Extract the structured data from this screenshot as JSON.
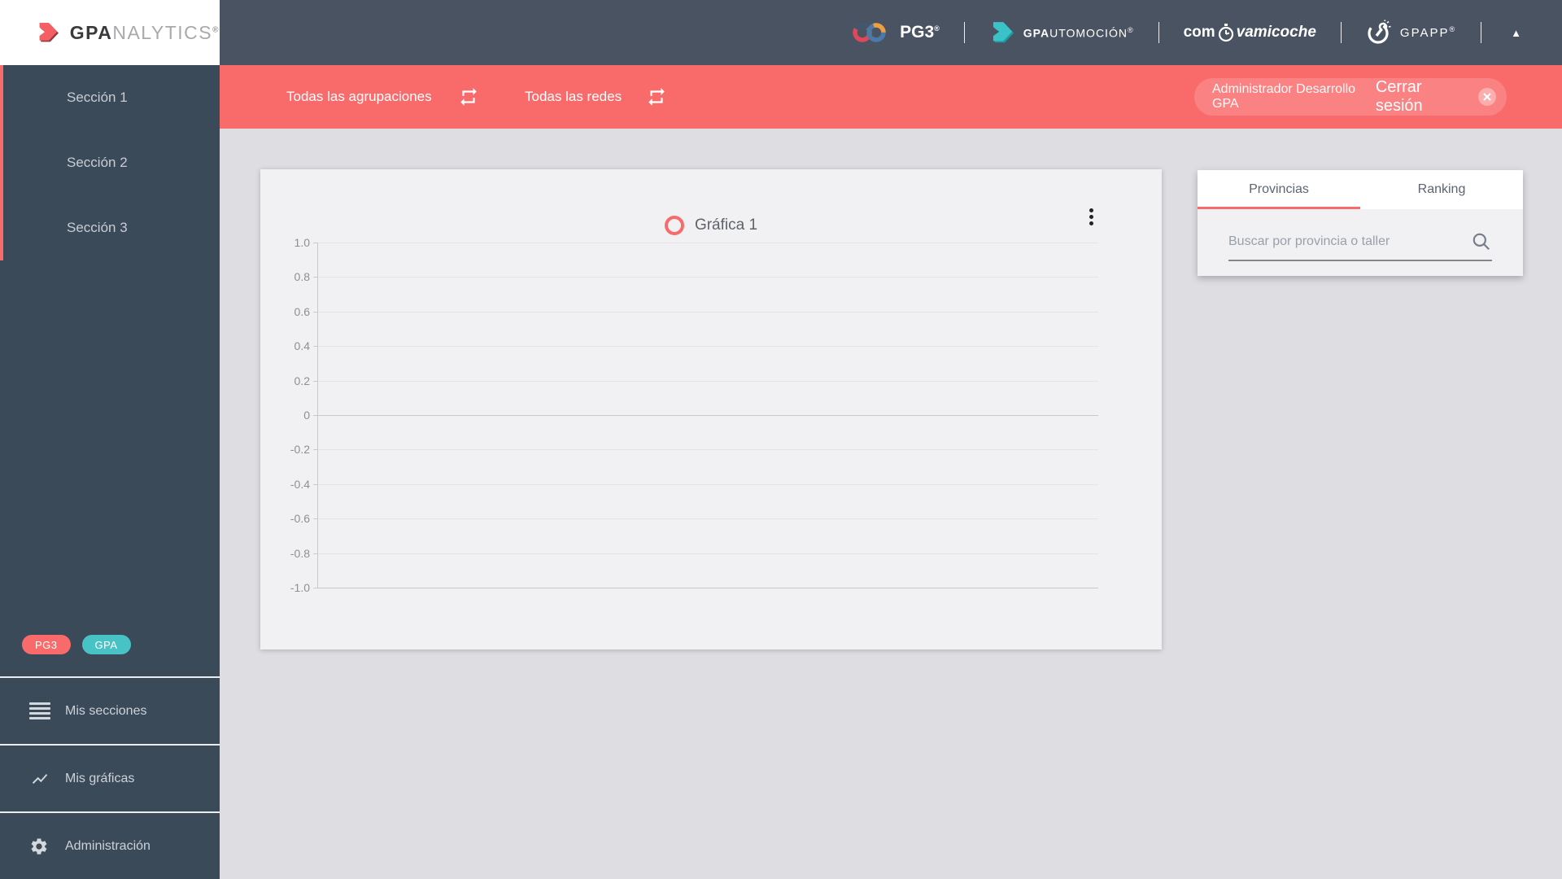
{
  "app": {
    "logo_bold": "GPA",
    "logo_light": "NALYTICS",
    "logo_reg": "®"
  },
  "sidebar": {
    "sections": [
      {
        "label": "Sección 1"
      },
      {
        "label": "Sección 2"
      },
      {
        "label": "Sección 3"
      }
    ],
    "badges": {
      "pg3": "PG3",
      "gpa": "GPA"
    },
    "menu": {
      "secciones": "Mis secciones",
      "graficas": "Mis gráficas",
      "administracion": "Administración"
    }
  },
  "header": {
    "pg3": "PG3",
    "pg3_reg": "®",
    "gpauto_bold": "GPA",
    "gpauto_rest": "UTOMOCIÓN",
    "gpauto_reg": "®",
    "comprova_left": "com",
    "comprova_right": "vamicoche",
    "gpapp": "GPAPP",
    "gpapp_reg": "®",
    "collapse_icon": "▲"
  },
  "filterbar": {
    "agrupaciones": "Todas las agrupaciones",
    "redes": "Todas las redes",
    "user": "Administrador Desarrollo GPA",
    "logout": "Cerrar sesión"
  },
  "chart_card": {
    "legend": "Gráfica 1"
  },
  "chart_data": {
    "type": "line",
    "title": "Gráfica 1",
    "series": [
      {
        "name": "Gráfica 1",
        "x": [],
        "values": []
      }
    ],
    "y_ticks": [
      "1.0",
      "0.8",
      "0.6",
      "0.4",
      "0.2",
      "0",
      "-0.2",
      "-0.4",
      "-0.6",
      "-0.8",
      "-1.0"
    ],
    "ylim": [
      -1.0,
      1.0
    ],
    "xlabel": "",
    "ylabel": "",
    "grid": true,
    "legend_position": "top-center"
  },
  "panel": {
    "tab_provincias": "Provincias",
    "tab_ranking": "Ranking",
    "search_placeholder": "Buscar por provincia o taller"
  },
  "colors": {
    "accent_red": "#f96b6b",
    "teal": "#47c3c6",
    "header_bg": "#4a5362",
    "sidebar_bg": "#3b4a59",
    "page_bg": "#dedee2",
    "card_bg": "#f1f1f4"
  }
}
